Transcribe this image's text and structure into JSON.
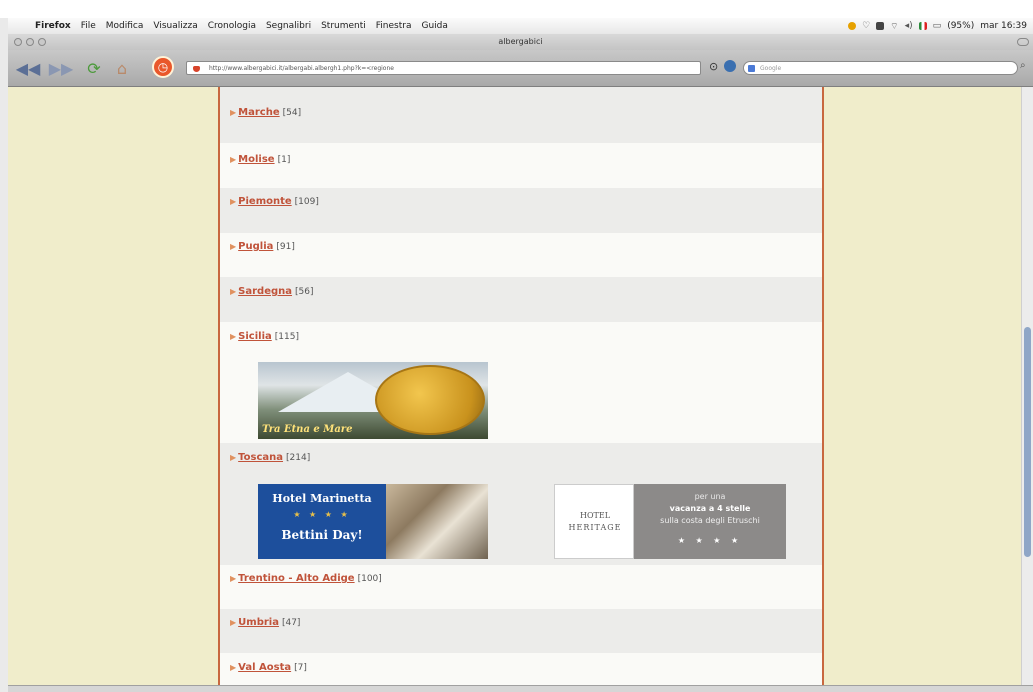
{
  "menubar": {
    "app": "Firefox",
    "items": [
      "File",
      "Modifica",
      "Visualizza",
      "Cronologia",
      "Segnalibri",
      "Strumenti",
      "Finestra",
      "Guida"
    ],
    "battery": "(95%)",
    "clock": "mar 16:39"
  },
  "window": {
    "title": "albergabici"
  },
  "toolbar": {
    "url": "http://www.albergabici.it/albergabi.albergh1.php?k=<regione",
    "search_placeholder": "Google"
  },
  "regions": [
    {
      "name": "Marche",
      "count": "[54]"
    },
    {
      "name": "Molise",
      "count": "[1]"
    },
    {
      "name": "Piemonte",
      "count": "[109]"
    },
    {
      "name": "Puglia",
      "count": "[91]"
    },
    {
      "name": "Sardegna",
      "count": "[56]"
    },
    {
      "name": "Sicilia",
      "count": "[115]"
    },
    {
      "name": "Toscana",
      "count": "[214]"
    },
    {
      "name": "Trentino - Alto Adige",
      "count": "[100]"
    },
    {
      "name": "Umbria",
      "count": "[47]"
    },
    {
      "name": "Val Aosta",
      "count": "[7]"
    }
  ],
  "banners": {
    "etna": {
      "caption": "Tra Etna e Mare"
    },
    "marinetta": {
      "title": "Hotel Marinetta",
      "stars": "★ ★ ★ ★",
      "subtitle": "Bettini Day!"
    },
    "heritage": {
      "logo_line1": "HOTEL",
      "logo_line2": "HERITAGE",
      "line1": "per una",
      "line2": "vacanza a 4 stelle",
      "line3": "sulla costa degli Etruschi",
      "stars": "★ ★ ★ ★"
    }
  },
  "colors": {
    "link": "#c0533a",
    "column_border": "#c8683f",
    "page_background": "#f0edcb",
    "marinetta_blue": "#1d4f9c"
  }
}
